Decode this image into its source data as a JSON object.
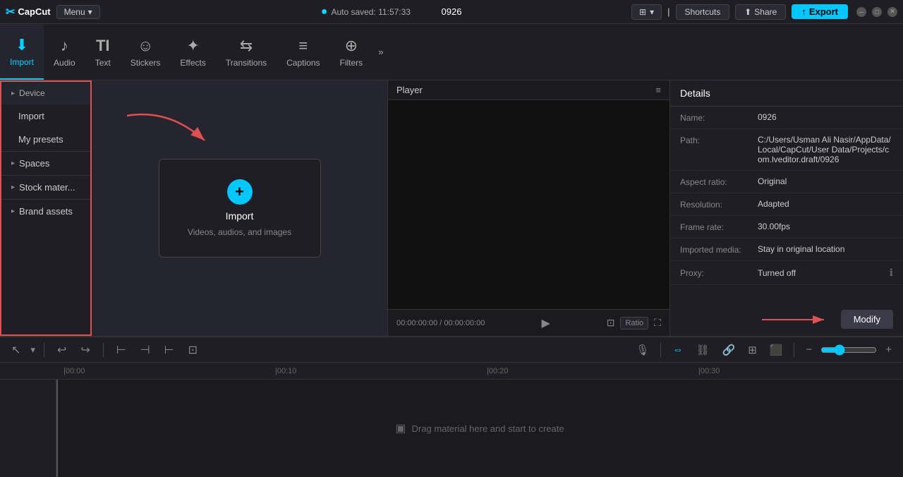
{
  "app": {
    "name": "CapCut",
    "menu_label": "Menu",
    "autosave": "Auto saved: 11:57:33",
    "project_name": "0926"
  },
  "topbar": {
    "shortcuts_label": "Shortcuts",
    "share_label": "Share",
    "export_label": "Export"
  },
  "toolbar": {
    "items": [
      {
        "id": "import",
        "label": "Import",
        "icon": "⬇"
      },
      {
        "id": "audio",
        "label": "Audio",
        "icon": "♪"
      },
      {
        "id": "text",
        "label": "Text",
        "icon": "T"
      },
      {
        "id": "stickers",
        "label": "Stickers",
        "icon": "☺"
      },
      {
        "id": "effects",
        "label": "Effects",
        "icon": "✦"
      },
      {
        "id": "transitions",
        "label": "Transitions",
        "icon": "▷◁"
      },
      {
        "id": "captions",
        "label": "Captions",
        "icon": "≡"
      },
      {
        "id": "filters",
        "label": "Filters",
        "icon": "⊕"
      }
    ],
    "more_icon": "»"
  },
  "sidebar": {
    "items": [
      {
        "id": "device",
        "label": "Device",
        "has_arrow": true,
        "active": true
      },
      {
        "id": "import",
        "label": "Import",
        "has_arrow": false,
        "active": false
      },
      {
        "id": "my-presets",
        "label": "My presets",
        "has_arrow": false,
        "active": false
      },
      {
        "id": "spaces",
        "label": "Spaces",
        "has_arrow": true,
        "active": false
      },
      {
        "id": "stock-material",
        "label": "Stock mater...",
        "has_arrow": true,
        "active": false
      },
      {
        "id": "brand-assets",
        "label": "Brand assets",
        "has_arrow": true,
        "active": false
      }
    ]
  },
  "content": {
    "import_label": "Import",
    "import_sublabel": "Videos, audios, and images",
    "import_icon": "+"
  },
  "player": {
    "title": "Player",
    "time_current": "00:00:00:00",
    "time_total": "00:00:00:00",
    "ratio_label": "Ratio"
  },
  "details": {
    "title": "Details",
    "rows": [
      {
        "label": "Name:",
        "value": "0926"
      },
      {
        "label": "Path:",
        "value": "C:/Users/Usman Ali Nasir/AppData/Local/CapCut/User Data/Projects/com.lveditor.draft/0926"
      },
      {
        "label": "Aspect ratio:",
        "value": "Original"
      },
      {
        "label": "Resolution:",
        "value": "Adapted"
      },
      {
        "label": "Frame rate:",
        "value": "30.00fps"
      },
      {
        "label": "Imported media:",
        "value": "Stay in original location"
      },
      {
        "label": "Proxy:",
        "value": "Turned off"
      }
    ],
    "modify_label": "Modify"
  },
  "timeline": {
    "drag_hint": "Drag material here and start to create",
    "rulers": [
      "00:00",
      "00:10",
      "00:20",
      "00:30"
    ],
    "ruler_positions": [
      90,
      390,
      690,
      990
    ]
  }
}
